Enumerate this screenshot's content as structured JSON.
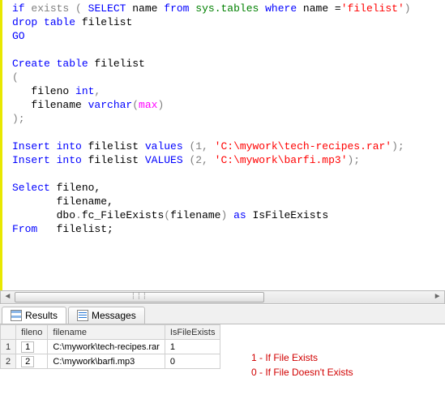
{
  "sql": {
    "l1_if": "if",
    "l1_exists": "exists",
    "l1_paren_o": " ( ",
    "l1_select": "SELECT",
    "l1_name": " name ",
    "l1_from": "from",
    "l1_sys": " sys.tables ",
    "l1_where": "where",
    "l1_name2": " name =",
    "l1_str": "'filelist'",
    "l1_paren_c": ")",
    "l2_drop": "drop",
    "l2_table": " table",
    "l2_fl": " filelist",
    "l3_go": "GO",
    "l5_create": "Create",
    "l5_table": " table",
    "l5_fl": " filelist",
    "l6_open": "(",
    "l7_fn": "   fileno ",
    "l7_int": "int",
    "l7_c": ",",
    "l8_fn": "   filename ",
    "l8_vc": "varchar",
    "l8_op": "(",
    "l8_max": "max",
    "l8_cp": ")",
    "l9_close": ");",
    "l11_ins": "Insert",
    "l11_into": " into",
    "l11_tbl": " filelist ",
    "l11_vals": "values",
    "l11_p": " (1, ",
    "l11_str": "'C:\\mywork\\tech-recipes.rar'",
    "l11_e": ");",
    "l12_ins": "Insert",
    "l12_into": " into",
    "l12_tbl": " filelist ",
    "l12_vals": "VALUES",
    "l12_p": " (2, ",
    "l12_str": "'C:\\mywork\\barfi.mp3'",
    "l12_e": ");",
    "l14_sel": "Select",
    "l14_c1": " fileno,",
    "l15_c2": "       filename,",
    "l16_pad": "       dbo",
    "l16_dot": ".",
    "l16_fn": "fc_FileExists",
    "l16_op": "(",
    "l16_arg": "filename",
    "l16_cp": ")",
    "l16_as": " as",
    "l16_al": " IsFileExists",
    "l17_from": "From",
    "l17_tbl": "   filelist;"
  },
  "tabs": {
    "results": "Results",
    "messages": "Messages"
  },
  "grid": {
    "headers": {
      "c0": "",
      "c1": "fileno",
      "c2": "filename",
      "c3": "IsFileExists"
    },
    "rows": [
      {
        "num": "1",
        "fileno": "1",
        "filename": "C:\\mywork\\tech-recipes.rar",
        "exists": "1"
      },
      {
        "num": "2",
        "fileno": "2",
        "filename": "C:\\mywork\\barfi.mp3",
        "exists": "0"
      }
    ]
  },
  "annotation": {
    "line1": "1 - If File Exists",
    "line2": "0 - If File Doesn't Exists"
  }
}
